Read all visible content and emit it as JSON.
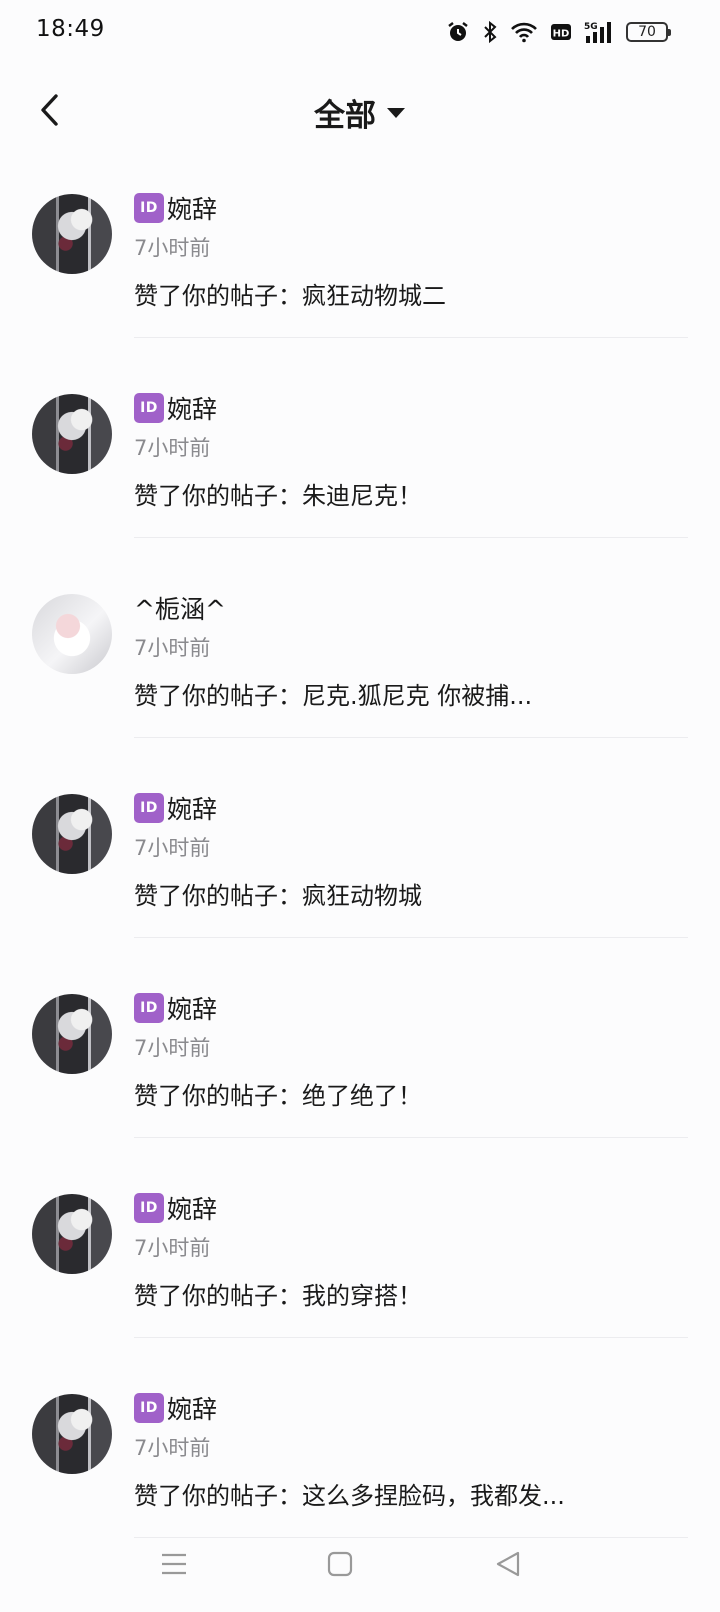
{
  "status_bar": {
    "time": "18:49",
    "battery_level": "70",
    "icons": [
      "alarm-icon",
      "bluetooth-icon",
      "wifi-icon",
      "hd-icon",
      "5g-signal-icon",
      "battery-icon"
    ]
  },
  "header": {
    "title": "全部",
    "back_icon": "chevron-left-icon",
    "dropdown_icon": "caret-down-icon"
  },
  "notifications": [
    {
      "avatar": "dark",
      "badge": "ID",
      "name": "婉辞",
      "time": "7小时前",
      "content": "赞了你的帖子：疯狂动物城二"
    },
    {
      "avatar": "dark",
      "badge": "ID",
      "name": "婉辞",
      "time": "7小时前",
      "content": "赞了你的帖子：朱迪尼克！"
    },
    {
      "avatar": "light",
      "badge": "",
      "name": "^栀涵^",
      "time": "7小时前",
      "content": "赞了你的帖子：尼克.狐尼克 你被捕..."
    },
    {
      "avatar": "dark",
      "badge": "ID",
      "name": "婉辞",
      "time": "7小时前",
      "content": "赞了你的帖子：疯狂动物城"
    },
    {
      "avatar": "dark",
      "badge": "ID",
      "name": "婉辞",
      "time": "7小时前",
      "content": "赞了你的帖子：绝了绝了！"
    },
    {
      "avatar": "dark",
      "badge": "ID",
      "name": "婉辞",
      "time": "7小时前",
      "content": "赞了你的帖子：我的穿搭！"
    },
    {
      "avatar": "dark",
      "badge": "ID",
      "name": "婉辞",
      "time": "7小时前",
      "content": "赞了你的帖子：这么多捏脸码，我都发..."
    }
  ],
  "nav_bar": {
    "icons": [
      "menu-icon",
      "home-square-icon",
      "back-triangle-icon"
    ]
  },
  "colors": {
    "id_badge": "#a061c9",
    "secondary_text": "#8a8a8e",
    "background": "#fcfcfd"
  }
}
